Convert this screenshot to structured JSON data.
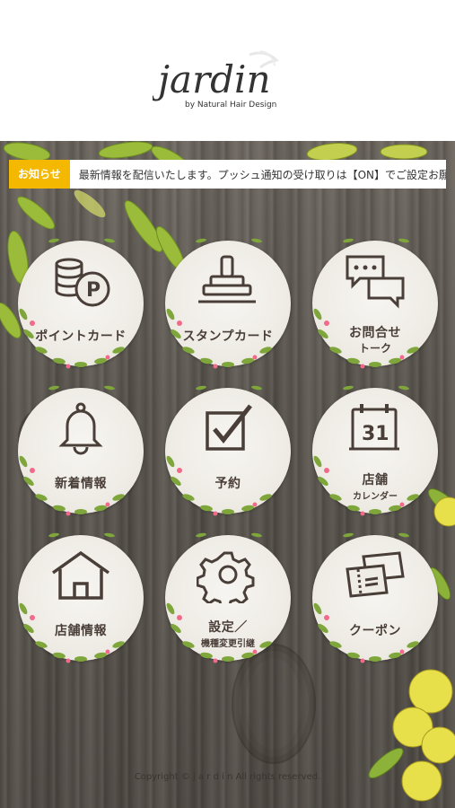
{
  "brand": {
    "name": "jardin",
    "tagline": "by Natural Hair Design"
  },
  "news": {
    "badge": "お知らせ",
    "text": "最新情報を配信いたします。プッシュ通知の受け取りは【ON】でご設定お願いします。"
  },
  "menu": [
    {
      "label": "ポイントカード",
      "icon": "points-coin-icon"
    },
    {
      "label": "スタンプカード",
      "icon": "stamp-icon"
    },
    {
      "label": "お問合せ",
      "sub": "トーク",
      "icon": "chat-bubbles-icon"
    },
    {
      "label": "新着情報",
      "icon": "bell-icon"
    },
    {
      "label": "予約",
      "icon": "checkbox-icon"
    },
    {
      "label": "店舗",
      "sub": "カレンダー",
      "icon": "calendar-icon",
      "calendar_day": "31"
    },
    {
      "label": "店舗情報",
      "icon": "house-icon"
    },
    {
      "label": "設定／",
      "sub": "機種変更引継",
      "icon": "gear-icon"
    },
    {
      "label": "クーポン",
      "icon": "coupon-tickets-icon"
    }
  ],
  "footer": {
    "copyright": "Copyright © j a r d i n All rights reserved."
  },
  "colors": {
    "badge": "#f4b800",
    "icon": "#4a3e38",
    "leaf": "#7fa63a",
    "flower": "#f06b8a"
  }
}
